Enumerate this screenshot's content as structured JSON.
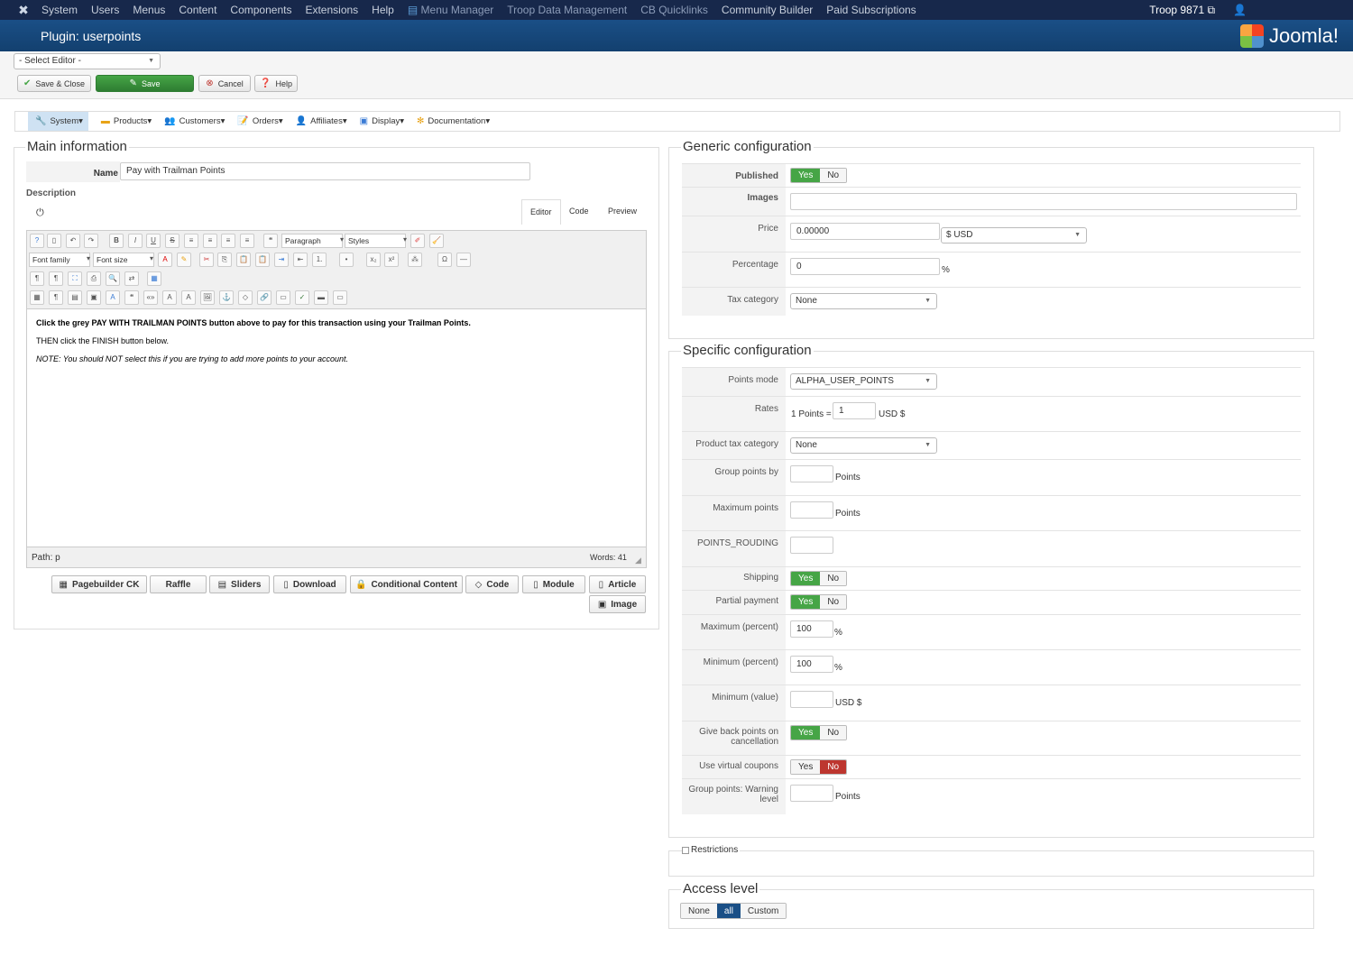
{
  "topnav": {
    "items": [
      "System",
      "Users",
      "Menus",
      "Content",
      "Components",
      "Extensions",
      "Help",
      "Menu Manager",
      "Troop Data Management",
      "CB Quicklinks",
      "Community Builder",
      "Paid Subscriptions"
    ],
    "troop": "Troop 9871"
  },
  "header": {
    "title": "Plugin: userpoints",
    "brand": "Joomla!"
  },
  "toolbar": {
    "editor_select": "- Select Editor -",
    "save_close": "Save & Close",
    "save": "Save",
    "cancel": "Cancel",
    "help": "Help"
  },
  "compmenu": {
    "items": [
      "System",
      "Products",
      "Customers",
      "Orders",
      "Affiliates",
      "Display",
      "Documentation"
    ]
  },
  "main": {
    "legend": "Main information",
    "name_label": "Name",
    "name_value": "Pay with Trailman Points",
    "description_label": "Description",
    "tabs": [
      "Editor",
      "Code",
      "Preview"
    ],
    "toolbar": {
      "paragraph": "Paragraph",
      "styles": "Styles",
      "font_family": "Font family",
      "font_size": "Font size"
    },
    "content": [
      "Click the grey PAY WITH TRAILMAN POINTS button above to pay for this transaction using your Trailman Points.",
      "THEN click the FINISH button below.",
      "NOTE: You should NOT select this if you are trying to add more points to your account."
    ],
    "path_label": "Path:",
    "path_value": "p",
    "words_label": "Words:",
    "words_value": "41",
    "buttons": [
      "Pagebuilder CK",
      "Raffle",
      "Sliders",
      "Download",
      "Conditional Content",
      "Code",
      "Module",
      "Article",
      "Image"
    ]
  },
  "generic": {
    "legend": "Generic configuration",
    "published_label": "Published",
    "images_label": "Images",
    "price_label": "Price",
    "price_value": "0.00000",
    "currency": "$ USD",
    "percentage_label": "Percentage",
    "percentage_value": "0",
    "percent_unit": "%",
    "tax_label": "Tax category",
    "tax_value": "None"
  },
  "specific": {
    "legend": "Specific configuration",
    "points_mode_label": "Points mode",
    "points_mode_value": "ALPHA_USER_POINTS",
    "rates_label": "Rates",
    "rates_prefix": "1 Points =",
    "rates_value": "1",
    "rates_unit": "USD $",
    "product_tax_label": "Product tax category",
    "product_tax_value": "None",
    "group_points_label": "Group points by",
    "points_unit": "Points",
    "max_points_label": "Maximum points",
    "rouding_label": "POINTS_ROUDING",
    "shipping_label": "Shipping",
    "partial_label": "Partial payment",
    "max_percent_label": "Maximum (percent)",
    "max_percent_value": "100",
    "min_percent_label": "Minimum (percent)",
    "min_percent_value": "100",
    "min_value_label": "Minimum (value)",
    "usd_unit": "USD $",
    "give_back_label": "Give back points on cancellation",
    "virtual_label": "Use virtual coupons",
    "warning_label": "Group points: Warning level"
  },
  "yesno": {
    "yes": "Yes",
    "no": "No"
  },
  "restrictions": "Restrictions",
  "access": {
    "legend": "Access level",
    "options": [
      "None",
      "all",
      "Custom"
    ]
  }
}
